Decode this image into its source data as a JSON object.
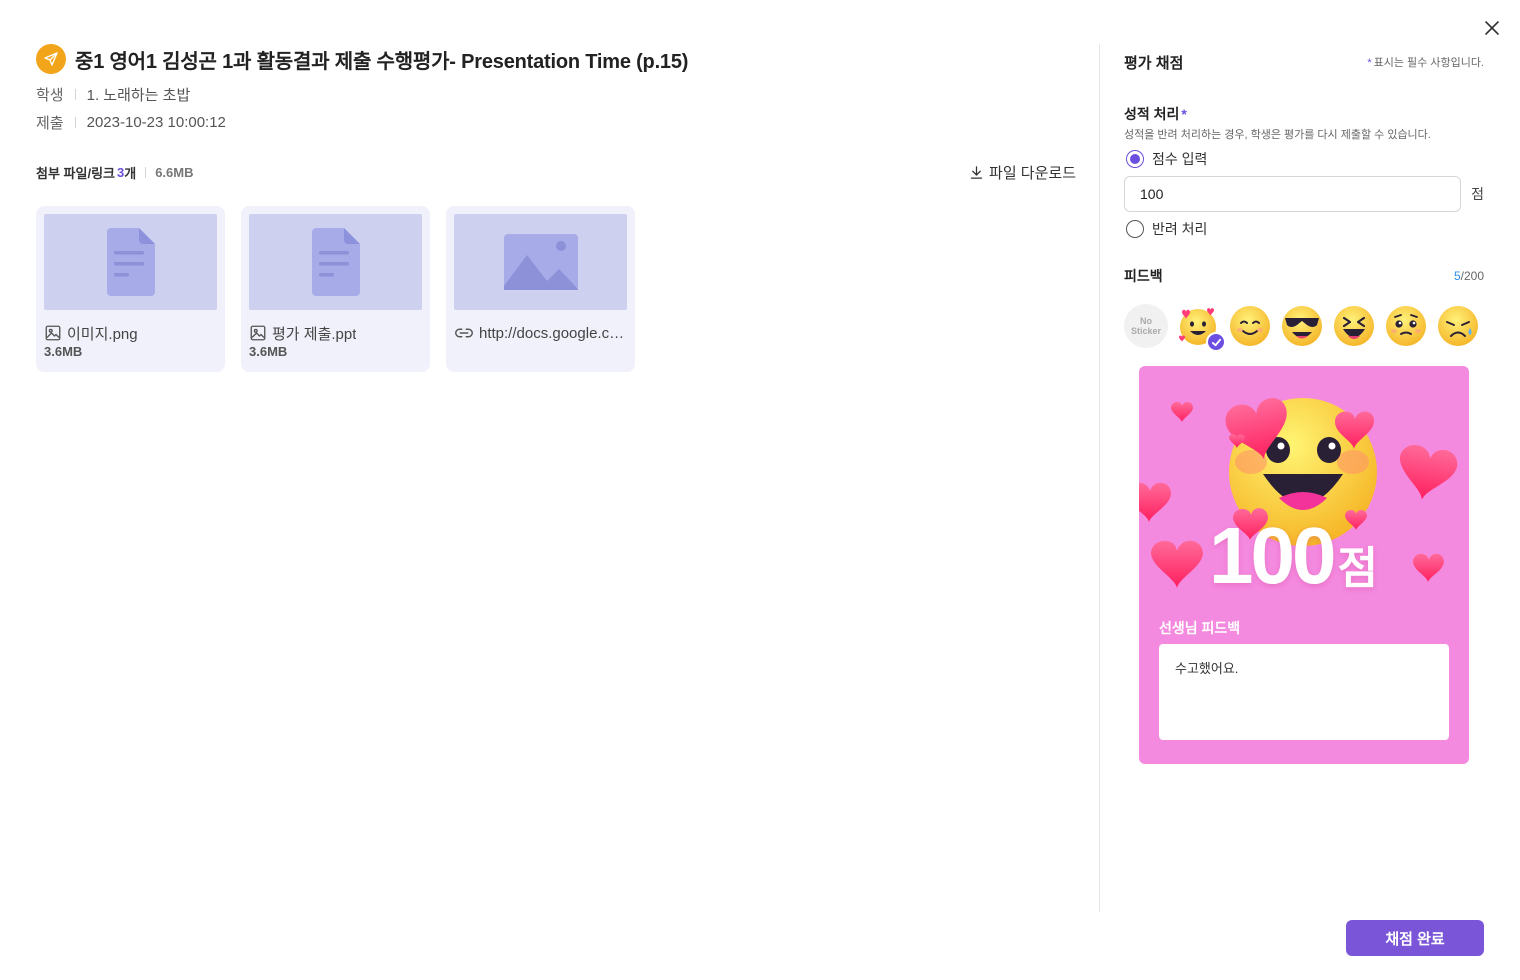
{
  "submission": {
    "title": "중1 영어1 김성곤 1과 활동결과 제출 수행평가- Presentation Time (p.15)",
    "student_label": "학생",
    "student_value": "1. 노래하는 초밥",
    "submitted_label": "제출",
    "submitted_value": "2023-10-23 10:00:12"
  },
  "attachments": {
    "title": "첨부 파일/링크",
    "count": "3",
    "count_suffix": "개",
    "total_size": "6.6MB",
    "download_label": "파일 다운로드",
    "items": [
      {
        "type": "image-file",
        "icon": "image-icon",
        "name": "이미지.png",
        "size": "3.6MB"
      },
      {
        "type": "document-file",
        "icon": "image-icon",
        "name": "평가 제출.ppt",
        "size": "3.6MB"
      },
      {
        "type": "link",
        "icon": "link-icon",
        "name": "http://docs.google.com/presentation"
      }
    ]
  },
  "grading": {
    "title": "평가 채점",
    "required_mark": "*",
    "required_note": "표시는 필수 사항입니다.",
    "grade_label": "성적 처리",
    "grade_desc": "성적을 반려 처리하는 경우, 학생은 평가를 다시 제출할 수 있습니다.",
    "option_score": "점수 입력",
    "option_score_selected": true,
    "score_value": "100",
    "score_unit": "점",
    "option_reject": "반려 처리",
    "option_reject_selected": false
  },
  "feedback": {
    "title": "피드백",
    "count_current": "5",
    "count_max": "/200",
    "no_sticker_line1": "No",
    "no_sticker_line2": "Sticker",
    "stickers": [
      "hearts-face-icon",
      "smiling-face-icon",
      "sunglasses-face-icon",
      "laughing-face-icon",
      "pleading-face-icon",
      "crying-face-icon"
    ],
    "selected_sticker": "hearts-face-icon"
  },
  "preview": {
    "score": "100",
    "unit": "점",
    "feedback_label": "선생님 피드백",
    "feedback_text": "수고했어요.",
    "background_color": "#f48ae0"
  },
  "actions": {
    "complete_label": "채점 완료"
  },
  "colors": {
    "accent": "#6c4ee0",
    "button": "#7a55d8",
    "badge": "#f2a51a",
    "counter": "#2f8ef0"
  }
}
